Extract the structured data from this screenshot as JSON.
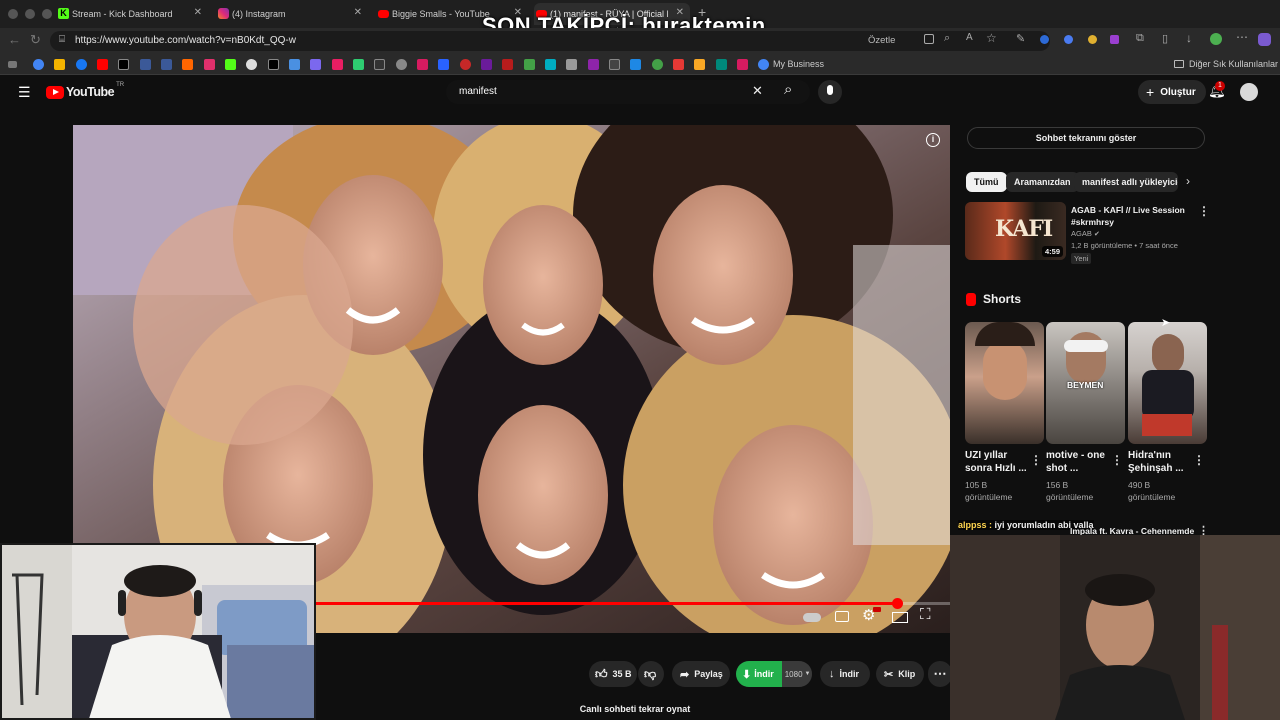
{
  "browser": {
    "tabs": [
      {
        "label": "Stream - Kick Dashboard",
        "color": "#53fc18"
      },
      {
        "label": "(4) Instagram",
        "color": "#e1306c"
      },
      {
        "label": "Biggie Smalls - YouTube",
        "color": "#ff0000"
      },
      {
        "label": "(1) manifest - RÜYA | Official M",
        "color": "#ff0000"
      }
    ],
    "url": "https://www.youtube.com/watch?v=nB0Kdt_QQ-w",
    "summarize_label": "Özetle",
    "bookmark_business": "My Business",
    "bookmark_other": "Diğer Sık Kullanılanlar"
  },
  "overlay": {
    "title": "SON TAKİPÇİ: buraktemin",
    "chat_user": "alppss :",
    "chat_message": "iyi yorumladın abi valla"
  },
  "youtube": {
    "logo": "YouTube",
    "logo_region": "TR",
    "search_value": "manifest",
    "create_label": "Oluştur",
    "notification_count": "1"
  },
  "player": {
    "progress": 0.94,
    "live_chat_replay": "Canlı sohbeti tekrar oynat"
  },
  "actions": {
    "likes": "35 B",
    "share": "Paylaş",
    "download_label": "İndir",
    "quality": "1080",
    "download2": "İndir",
    "clip": "Klip"
  },
  "sidebar": {
    "show_chat": "Sohbet tekranını göster",
    "chips": [
      "Tümü",
      "Aramanızdan",
      "manifest adlı yükleyiciden"
    ],
    "recommended": {
      "title_line1": "AGAB - KAFİ // Live Session",
      "title_line2": "#skrmhrsy",
      "channel": "AGAB",
      "meta": "1,2 B görüntüleme • 7 saat önce",
      "badge": "Yeni",
      "duration": "4:59",
      "thumb_text": "KAFI"
    },
    "shorts_heading": "Shorts",
    "shorts": [
      {
        "title1": "UZI yıllar",
        "title2": "sonra Hızlı ...",
        "views1": "105 B",
        "views2": "görüntüleme"
      },
      {
        "title1": "motive - one",
        "title2": "shot ...",
        "views1": "156 B",
        "views2": "görüntüleme",
        "thumb_text": "BEYMEN"
      },
      {
        "title1": "Hidra'nın",
        "title2": "Şehinşah ...",
        "views1": "490 B",
        "views2": "görüntüleme"
      }
    ],
    "next_item": "Impala ft. Kavra - Cehennemde"
  }
}
